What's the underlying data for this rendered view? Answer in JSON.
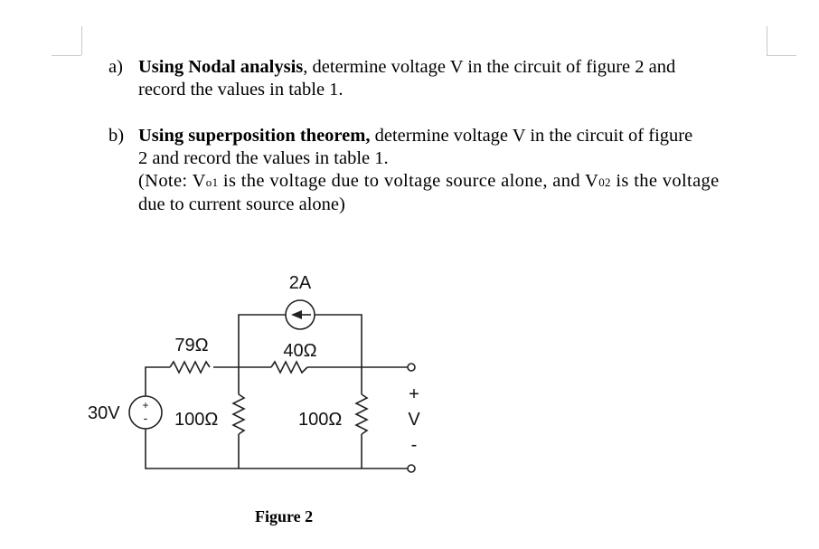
{
  "questions": [
    {
      "label": "a)",
      "bold": "Using Nodal analysis",
      "line1_rest": ", determine voltage V in the circuit of figure 2 and",
      "line2": "record the values in table 1."
    },
    {
      "label": "b)",
      "bold": "Using superposition theorem,",
      "line1_rest": " determine voltage V in the circuit of figure",
      "line2": "2 and record the values in table 1.",
      "note_pre": "(Note: V",
      "note_sub1": "o1",
      "note_mid": " is the voltage due to voltage source alone, and V",
      "note_sub2": "02",
      "note_post": " is the voltage",
      "line4": "due to current source alone)"
    }
  ],
  "figure": {
    "caption": "Figure 2",
    "components": {
      "current_source": "2A",
      "voltage_source": "30V",
      "r_series": "79Ω",
      "r_bridge": "40Ω",
      "r_shunt_left": "100Ω",
      "r_shunt_right": "100Ω"
    },
    "output": {
      "plus": "+",
      "label": "V",
      "minus": "-"
    }
  }
}
